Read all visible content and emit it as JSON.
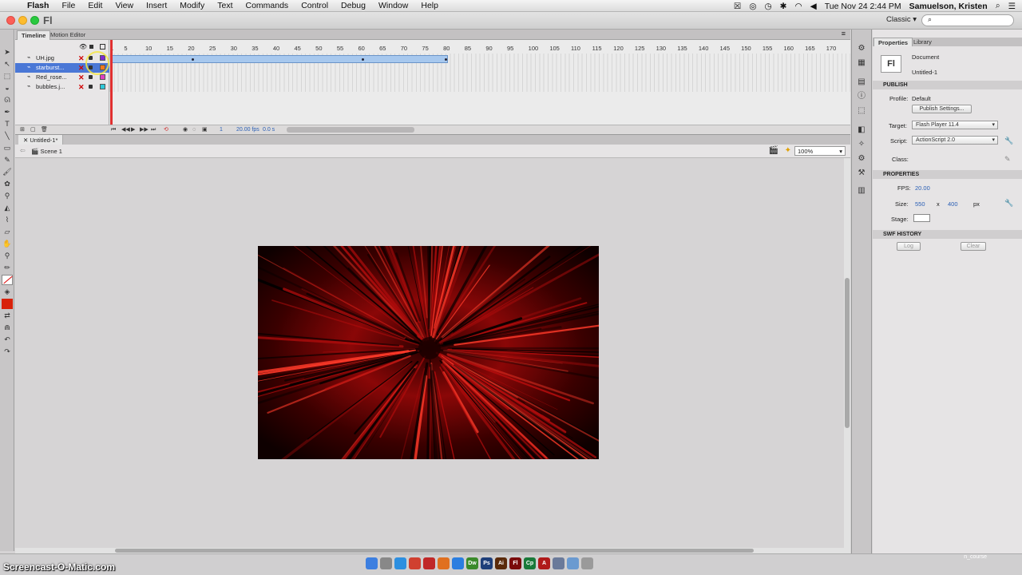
{
  "menubar": {
    "app": "Flash",
    "items": [
      "File",
      "Edit",
      "View",
      "Insert",
      "Modify",
      "Text",
      "Commands",
      "Control",
      "Debug",
      "Window",
      "Help"
    ],
    "clock": "Tue Nov 24  2:44 PM",
    "user": "Samuelson, Kristen"
  },
  "appbar": {
    "logo": "Fl",
    "workspace": "Classic ▾",
    "search_placeholder": ""
  },
  "timeline": {
    "tabs": [
      "Timeline",
      "Motion Editor"
    ],
    "layers": [
      {
        "name": "UH.jpg",
        "selected": false,
        "color": "#7d2bd1"
      },
      {
        "name": "starburst...",
        "selected": true,
        "color": "#f07a1c"
      },
      {
        "name": "Red_rose...",
        "selected": false,
        "color": "#e040c0"
      },
      {
        "name": "bubbles.j...",
        "selected": false,
        "color": "#2ec8d8"
      }
    ],
    "ruler": [
      "1",
      "5",
      "10",
      "15",
      "20",
      "25",
      "30",
      "35",
      "40",
      "45",
      "50",
      "55",
      "60",
      "65",
      "70",
      "75",
      "80",
      "85",
      "90",
      "95",
      "100",
      "105",
      "110",
      "115",
      "120",
      "125",
      "130",
      "135",
      "140",
      "145",
      "150",
      "155",
      "160",
      "165",
      "170"
    ],
    "footer_frame": "1",
    "footer_fps": "20.00 fps",
    "footer_time": "0.0 s"
  },
  "document": {
    "tab": "Untitled-1*",
    "scene": "Scene 1",
    "zoom": "100%"
  },
  "properties": {
    "tabs": [
      "Properties",
      "Library"
    ],
    "doc_type": "Document",
    "doc_name": "Untitled-1",
    "publish_header": "PUBLISH",
    "profile_label": "Profile:",
    "profile_value": "Default",
    "publish_settings": "Publish Settings...",
    "target_label": "Target:",
    "target_value": "Flash Player 11.4",
    "script_label": "Script:",
    "script_value": "ActionScript 2.0",
    "class_label": "Class:",
    "properties_header": "PROPERTIES",
    "fps_label": "FPS:",
    "fps_value": "20.00",
    "size_label": "Size:",
    "width": "550",
    "x": "x",
    "height": "400",
    "px": "px",
    "stage_label": "Stage:",
    "swf_header": "SWF HISTORY",
    "log": "Log",
    "clear": "Clear"
  },
  "dock": {
    "watermark": "Screencast-O-Matic.com",
    "ncourse": "n_course",
    "apps": [
      {
        "name": "finder",
        "color": "#3d7fe0",
        "label": ""
      },
      {
        "name": "launchpad",
        "color": "#888",
        "label": ""
      },
      {
        "name": "safari",
        "color": "#2d8fe0",
        "label": ""
      },
      {
        "name": "chrome",
        "color": "#d04030",
        "label": ""
      },
      {
        "name": "photo-booth",
        "color": "#c02828",
        "label": ""
      },
      {
        "name": "firefox",
        "color": "#e07020",
        "label": ""
      },
      {
        "name": "app-store",
        "color": "#2b7ee0",
        "label": ""
      },
      {
        "name": "dreamweaver",
        "color": "#3a8a2a",
        "label": "Dw"
      },
      {
        "name": "photoshop",
        "color": "#1e3f7a",
        "label": "Ps"
      },
      {
        "name": "illustrator",
        "color": "#5a2a0a",
        "label": "Ai"
      },
      {
        "name": "flash",
        "color": "#7a0a0a",
        "label": "Fl"
      },
      {
        "name": "captivate",
        "color": "#1a7a3a",
        "label": "Cp"
      },
      {
        "name": "acrobat",
        "color": "#b01a1a",
        "label": "A"
      },
      {
        "name": "preview",
        "color": "#6a7a9a",
        "label": ""
      },
      {
        "name": "folder",
        "color": "#6a9ad0",
        "label": ""
      },
      {
        "name": "trash",
        "color": "#9a9a9a",
        "label": ""
      }
    ]
  }
}
